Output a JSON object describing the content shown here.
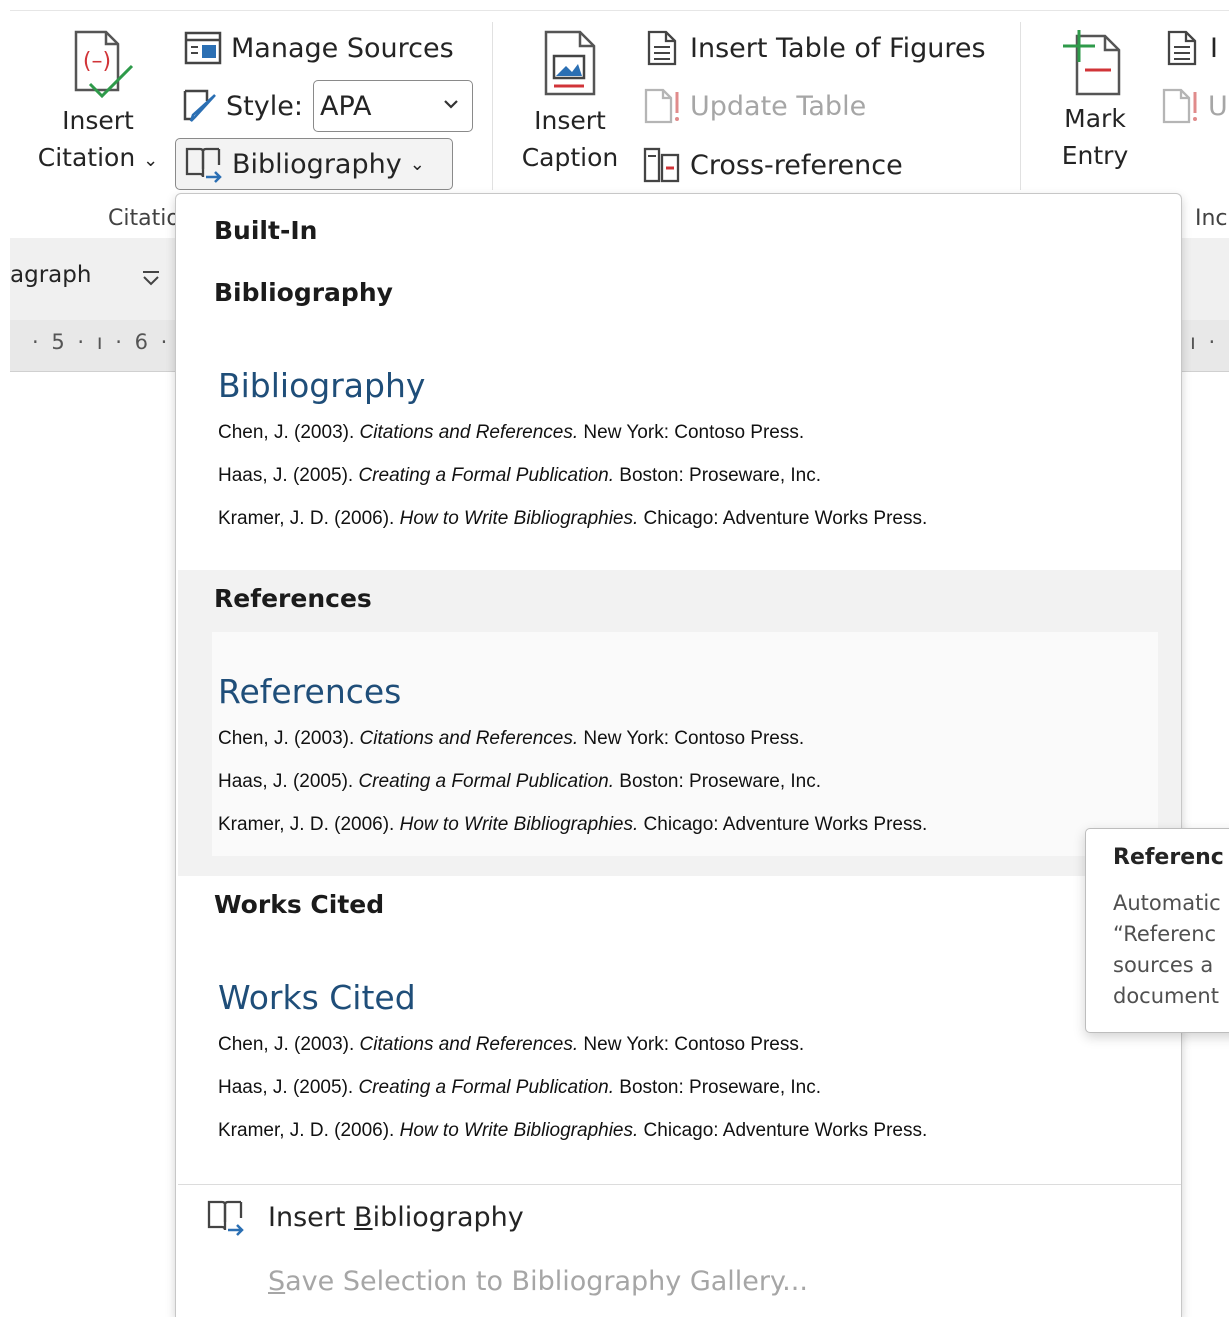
{
  "ribbon": {
    "insert_citation": {
      "line1": "Insert",
      "line2": "Citation"
    },
    "manage_sources": "Manage Sources",
    "style_label": "Style:",
    "style_value": "APA",
    "bibliography_button": "Bibliography",
    "citations_group_label": "Citatio",
    "insert_caption": {
      "line1": "Insert",
      "line2": "Caption"
    },
    "insert_table_of_figures": "Insert Table of Figures",
    "update_table": "Update Table",
    "cross_reference": "Cross-reference",
    "mark_entry": {
      "line1": "Mark",
      "line2": "Entry"
    },
    "index_group_label": "Inc",
    "index_partial_1": "I",
    "index_partial_2": "U"
  },
  "strip": {
    "paragraph_fragment": "agraph",
    "ruler_left": "· 5 · ı · 6 ·",
    "ruler_right": "ı ·"
  },
  "gallery": {
    "heading": "Built-In",
    "entries": {
      "e1": {
        "pre": "Chen, J. (2003). ",
        "title": "Citations and References.",
        "post": " New York: Contoso Press."
      },
      "e2": {
        "pre": "Haas, J. (2005). ",
        "title": "Creating a Formal Publication.",
        "post": " Boston: Proseware, Inc."
      },
      "e3": {
        "pre": "Kramer, J. D. (2006). ",
        "title": "How to Write Bibliographies.",
        "post": " Chicago: Adventure Works Press."
      }
    },
    "items": [
      {
        "label": "Bibliography",
        "title": "Bibliography"
      },
      {
        "label": "References",
        "title": "References"
      },
      {
        "label": "Works Cited",
        "title": "Works Cited"
      }
    ],
    "footer": {
      "insert_pre": "Insert ",
      "insert_key": "B",
      "insert_post": "ibliography",
      "save_key": "S",
      "save_post": "ave Selection to Bibliography Gallery..."
    }
  },
  "tooltip": {
    "title": "Referenc",
    "lines": [
      "Automatic",
      "“Referenc",
      "sources a",
      "document"
    ]
  },
  "colors": {
    "accent_title": "#1f4e79",
    "disabled_text": "#a6a6a6",
    "hover_band": "#f2f2f2"
  }
}
